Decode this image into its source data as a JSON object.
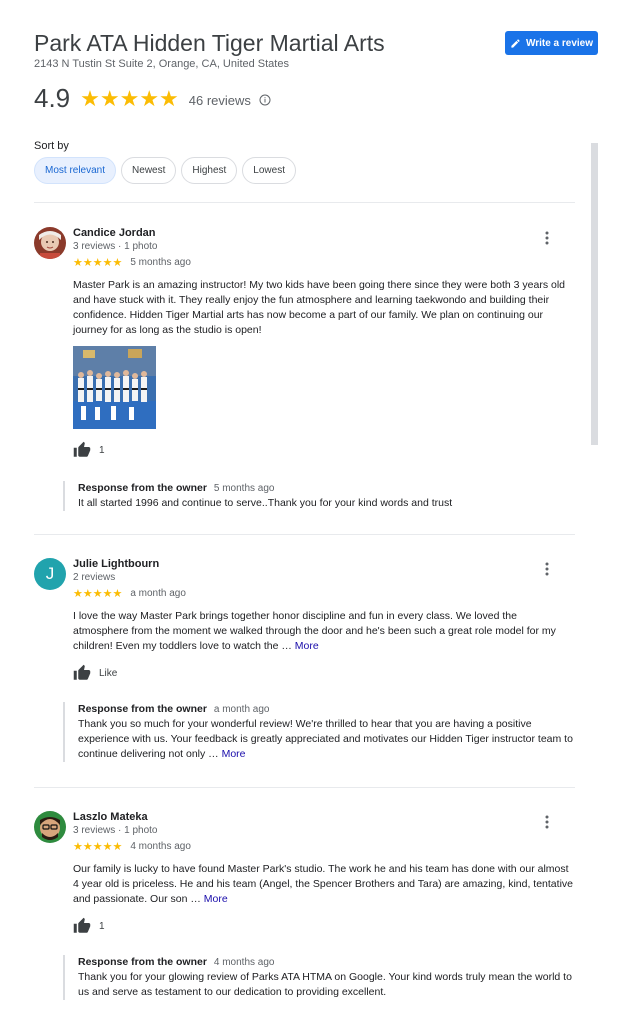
{
  "business": {
    "name": "Park ATA Hidden Tiger Martial Arts",
    "address": "2143 N Tustin St Suite 2, Orange, CA, United States",
    "rating": "4.9",
    "stars": "★★★★★",
    "review_count": "46 reviews"
  },
  "write_review_label": "Write a review",
  "sort": {
    "label": "Sort by",
    "options": [
      "Most relevant",
      "Newest",
      "Highest",
      "Lowest"
    ],
    "selected": "Most relevant"
  },
  "reviews": [
    {
      "name": "Candice Jordan",
      "meta": "3 reviews · 1 photo",
      "stars": "★★★★★",
      "date": "5 months ago",
      "text": "Master Park is an amazing instructor! My two kids have been going there since they were both 3 years old and have stuck with it. They really enjoy the fun atmosphere and learning taekwondo and building their confidence. Hidden Tiger Martial arts has now become a part of our family. We plan on continuing our journey for as long as the studio is open!",
      "likes": "1",
      "owner_label": "Response from the owner",
      "owner_date": "5 months ago",
      "owner_text": "It all started 1996 and continue to serve..Thank you for your kind words and trust"
    },
    {
      "name": "Julie Lightbourn",
      "meta": "2 reviews",
      "avatar_letter": "J",
      "stars": "★★★★★",
      "date": "a month ago",
      "text": "I love the way Master Park brings together honor discipline and fun in every class. We loved the atmosphere from the moment we walked through the door and he's been such a great role model for my children! Even my toddlers love to watch the …",
      "more": "More",
      "likes": "Like",
      "owner_label": "Response from the owner",
      "owner_date": "a month ago",
      "owner_text": "Thank you so much for your wonderful review! We're thrilled to hear that you are having a positive experience with us. Your feedback is greatly appreciated and motivates our Hidden Tiger instructor team to continue delivering not only …",
      "owner_more": "More"
    },
    {
      "name": "Laszlo Mateka",
      "meta": "3 reviews · 1 photo",
      "stars": "★★★★★",
      "date": "4 months ago",
      "text": "Our family is lucky to have found Master Park's studio. The work he and his team has done with our almost 4 year old is priceless. He and his team (Angel, the Spencer Brothers and Tara) are amazing, kind, tentative and passionate. Our son …",
      "more": "More",
      "likes": "1",
      "owner_label": "Response from the owner",
      "owner_date": "4 months ago",
      "owner_text": "Thank you for your glowing review of Parks ATA HTMA on Google. Your kind words truly mean the world to us and serve as testament to our dedication to providing excellent."
    }
  ],
  "colors": {
    "accent": "#1a73e8",
    "star": "#fbbc04",
    "chip_active_bg": "#e8f0fe",
    "avatar_teal": "#21a3ad"
  }
}
